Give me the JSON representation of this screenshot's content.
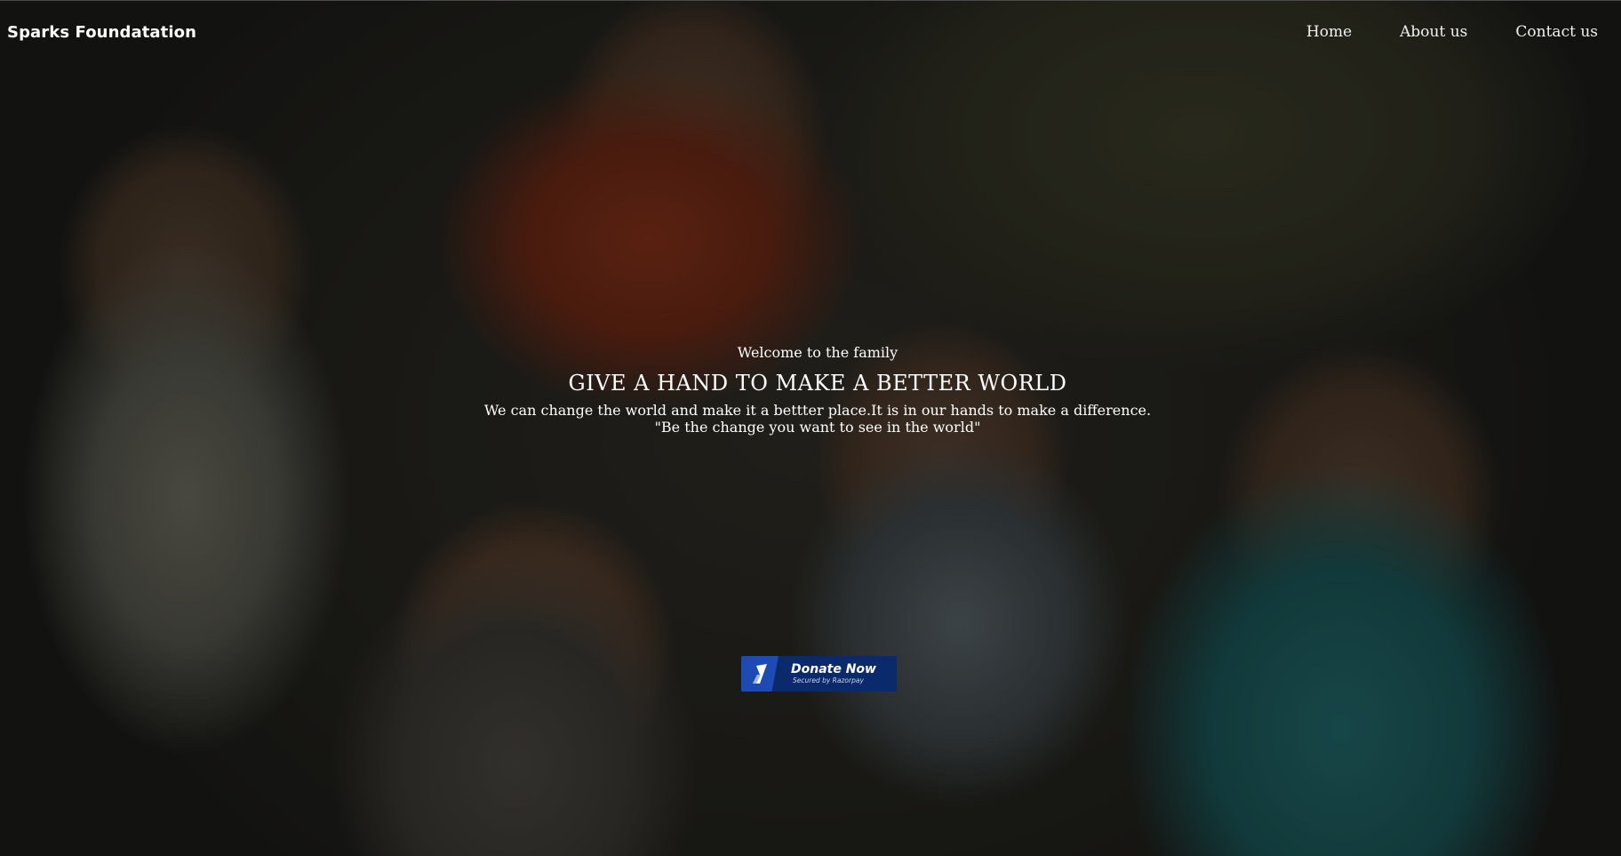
{
  "brand": "Sparks Foundatation",
  "nav": {
    "items": [
      {
        "label": "Home"
      },
      {
        "label": "About us"
      },
      {
        "label": "Contact us"
      }
    ]
  },
  "hero": {
    "welcome": "Welcome to the family",
    "headline": "GIVE A HAND TO MAKE A BETTER WORLD",
    "line1": "We can change the world and make it a bettter place.It is in our hands to make a difference.",
    "line2": "\"Be the change you want to see in the world\""
  },
  "donate": {
    "label": "Donate Now",
    "sub": "Secured by Razorpay",
    "icon": "razorpay-logo-icon",
    "colors": {
      "background": "#0b2a6b",
      "logo": "#1e4ab4"
    }
  }
}
